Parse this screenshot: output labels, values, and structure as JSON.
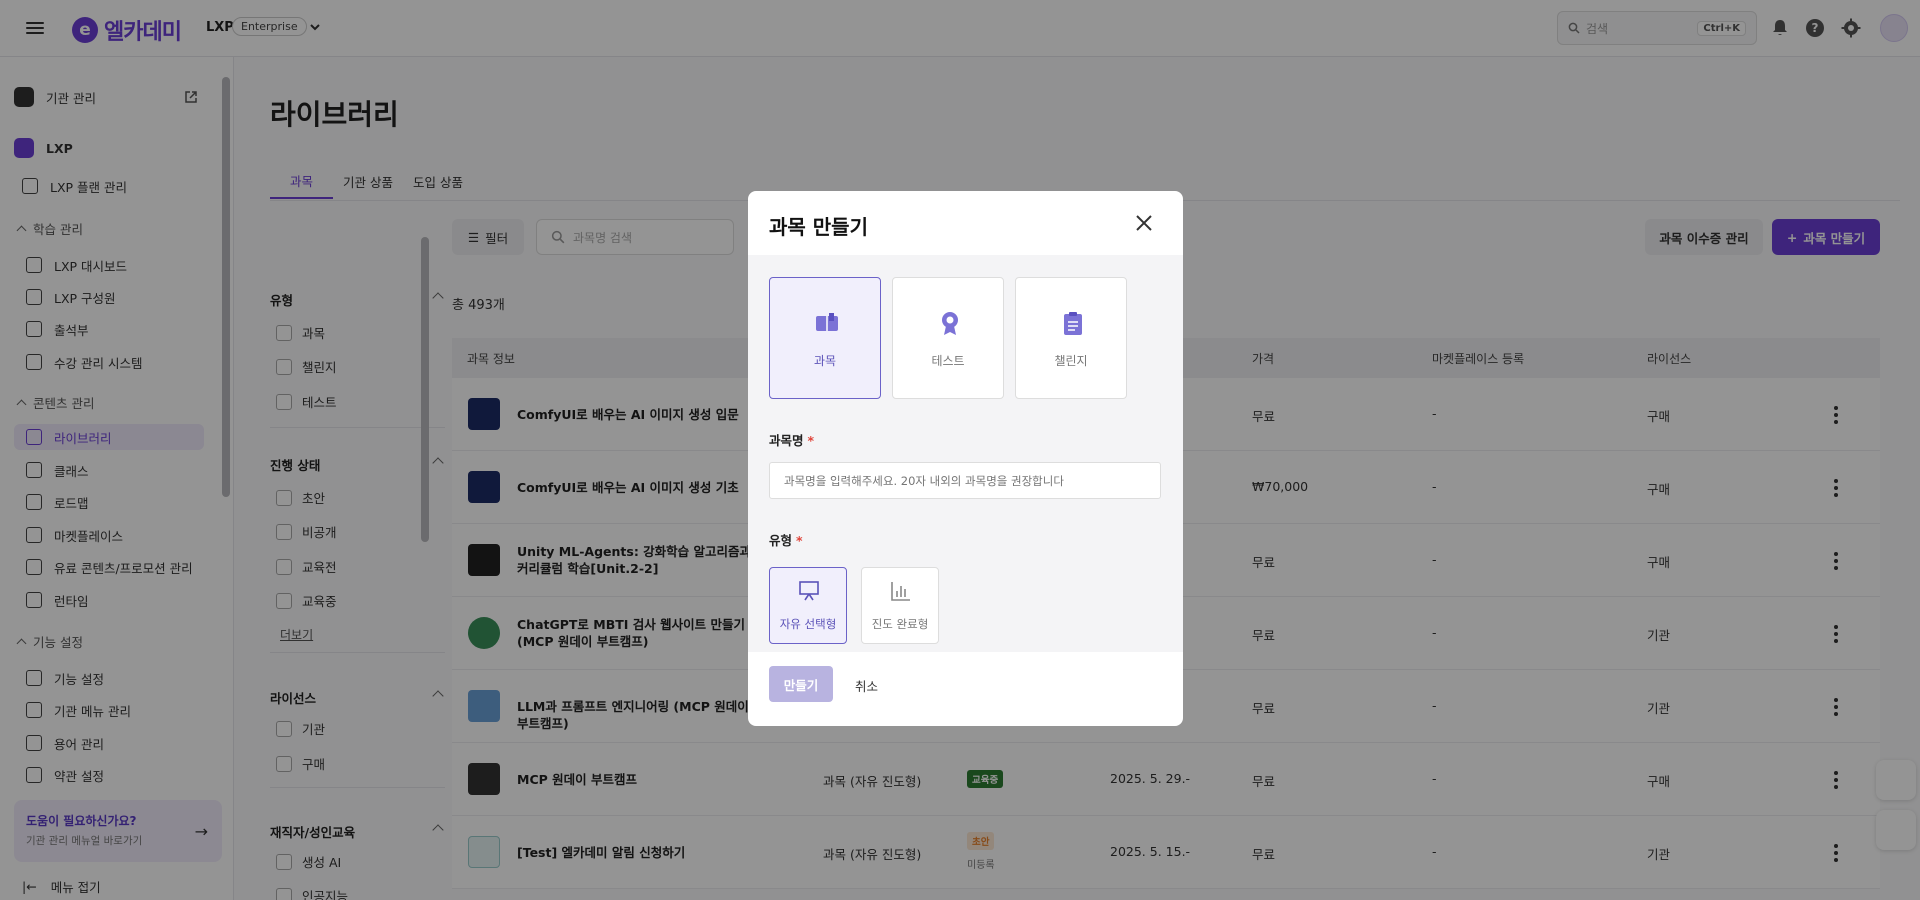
{
  "topbar": {
    "logo_mark": "e",
    "logo_text": "엘카데미",
    "product": "LXP",
    "edition_badge": "Enterprise",
    "search_placeholder": "검색",
    "search_shortcut": "Ctrl+K"
  },
  "sidebar": {
    "org_admin": "기관 관리",
    "lxp": "LXP",
    "lxp_plan": "LXP 플랜 관리",
    "section_learning": "학습 관리",
    "learning_items": [
      "LXP 대시보드",
      "LXP 구성원",
      "출석부",
      "수강 관리 시스템"
    ],
    "section_content": "콘텐츠 관리",
    "content_items": [
      "라이브러리",
      "클래스",
      "로드맵",
      "마켓플레이스",
      "유료 콘텐츠/프로모션 관리",
      "런타임"
    ],
    "section_features": "기능 설정",
    "feature_items": [
      "기능 설정",
      "기관 메뉴 관리",
      "용어 관리",
      "약관 설정"
    ],
    "help_title": "도움이 필요하신가요?",
    "help_sub": "기관 관리 메뉴얼 바로가기",
    "collapse": "메뉴 접기"
  },
  "main": {
    "title": "라이브러리",
    "tabs": [
      "과목",
      "기관 상품",
      "도입 상품"
    ],
    "filters": {
      "type_title": "유형",
      "type_options": [
        "과목",
        "챌린지",
        "테스트"
      ],
      "status_title": "진행 상태",
      "status_options": [
        "초안",
        "비공개",
        "교육전",
        "교육중"
      ],
      "more": "더보기",
      "license_title": "라이선스",
      "license_options": [
        "기관",
        "구매"
      ],
      "edu_title": "재직자/성인교육",
      "edu_options": [
        "생성 AI",
        "인공지능"
      ]
    },
    "filter_btn": "필터",
    "course_search_placeholder": "과목명 검색",
    "total": "총 493개",
    "cert_btn": "과목 이수증 관리",
    "create_btn": "과목 만들기",
    "columns": [
      "과목 정보",
      "가격",
      "마켓플레이스 등록",
      "라이선스"
    ],
    "rows": [
      {
        "title": "ComfyUI로 배우는 AI 이미지 생성 입문",
        "type": "",
        "status": "",
        "date": "",
        "price": "무료",
        "market": "-",
        "license": "구매"
      },
      {
        "title": "ComfyUI로 배우는 AI 이미지 생성 기초",
        "type": "",
        "status": "",
        "date": "",
        "price": "₩70,000",
        "market": "-",
        "license": "구매"
      },
      {
        "title": "Unity ML-Agents: 강화학습 알고리즘과 커리큘럼 학습[Unit.2-2]",
        "type": "",
        "status": "",
        "date": ".",
        "price": "무료",
        "market": "-",
        "license": "구매"
      },
      {
        "title": "ChatGPT로 MBTI 검사 웹사이트 만들기 (MCP 원데이 부트캠프)",
        "type": "",
        "status": "",
        "date": ".",
        "price": "무료",
        "market": "-",
        "license": "기관"
      },
      {
        "title": "LLM과 프롬프트 엔지니어링 (MCP 원데이 부트캠프)",
        "type": "",
        "status": "",
        "date": ".",
        "price": "무료",
        "market": "-",
        "license": "기관"
      },
      {
        "title": "MCP 원데이 부트캠프",
        "type": "과목 (자유 진도형)",
        "status": "교육중",
        "date": "2025. 5. 29.-",
        "price": "무료",
        "market": "-",
        "license": "구매"
      },
      {
        "title": "[Test] 엘카데미 알림 신청하기",
        "type": "과목 (자유 진도형)",
        "status": "초안",
        "status2": "미등록",
        "date": "2025. 5. 15.-",
        "price": "무료",
        "market": "-",
        "license": "기관"
      }
    ]
  },
  "modal": {
    "title": "과목 만들기",
    "kind_cards": [
      {
        "label": "과목",
        "icon": "book-icon",
        "selected": true
      },
      {
        "label": "테스트",
        "icon": "medal-icon",
        "selected": false
      },
      {
        "label": "챌린지",
        "icon": "clipboard-icon",
        "selected": false
      }
    ],
    "name_label": "과목명",
    "name_placeholder": "과목명을 입력해주세요. 20자 내외의 과목명을 권장합니다",
    "mode_label": "유형",
    "mode_cards": [
      {
        "label": "자유 선택형",
        "icon": "presentation-icon",
        "selected": true
      },
      {
        "label": "진도 완료형",
        "icon": "bar-chart-icon",
        "selected": false
      }
    ],
    "required_mark": "*",
    "submit": "만들기",
    "cancel": "취소"
  },
  "colors": {
    "accent": "#6b3fd6",
    "selected_border": "#6b62c8",
    "disabled_button": "#b8b3e0",
    "status_in_progress": "#2e7d32",
    "status_draft": "#e8812a"
  }
}
